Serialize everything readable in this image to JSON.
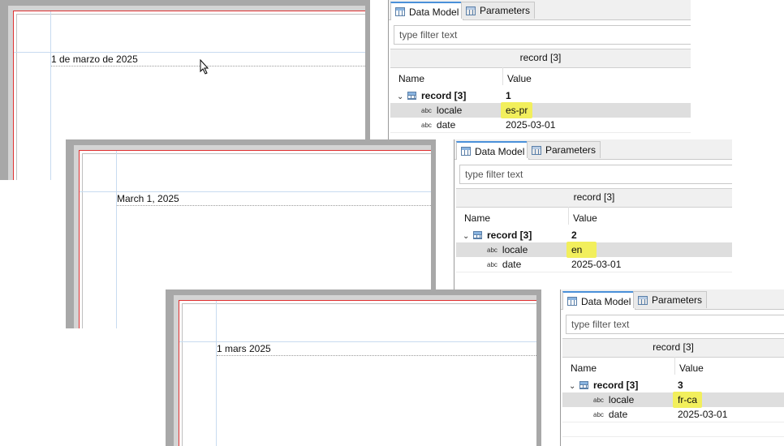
{
  "panels": [
    {
      "date_text": "1 de marzo de 2025",
      "tabs": {
        "data_model": "Data Model",
        "parameters": "Parameters"
      },
      "filter_placeholder": "type filter text",
      "record_header": "record [3]",
      "columns": {
        "name": "Name",
        "value": "Value"
      },
      "record": {
        "label": "record [3]",
        "value": "1"
      },
      "locale": {
        "label": "locale",
        "value": "es-pr"
      },
      "date": {
        "label": "date",
        "value": "2025-03-01"
      }
    },
    {
      "date_text": "March 1, 2025",
      "tabs": {
        "data_model": "Data Model",
        "parameters": "Parameters"
      },
      "filter_placeholder": "type filter text",
      "record_header": "record [3]",
      "columns": {
        "name": "Name",
        "value": "Value"
      },
      "record": {
        "label": "record [3]",
        "value": "2"
      },
      "locale": {
        "label": "locale",
        "value": "en"
      },
      "date": {
        "label": "date",
        "value": "2025-03-01"
      }
    },
    {
      "date_text": "1 mars 2025",
      "tabs": {
        "data_model": "Data Model",
        "parameters": "Parameters"
      },
      "filter_placeholder": "type filter text",
      "record_header": "record [3]",
      "columns": {
        "name": "Name",
        "value": "Value"
      },
      "record": {
        "label": "record [3]",
        "value": "3"
      },
      "locale": {
        "label": "locale",
        "value": "fr-ca"
      },
      "date": {
        "label": "date",
        "value": "2025-03-01"
      }
    }
  ],
  "colors": {
    "highlight": "#f2ef5c",
    "page_border": "#e03030",
    "tab_accent": "#4a90d9"
  },
  "icons": {
    "table": "table-icon",
    "string": "abc-icon",
    "expand": "chevron-down-icon",
    "pointer": "mouse-cursor-icon"
  }
}
